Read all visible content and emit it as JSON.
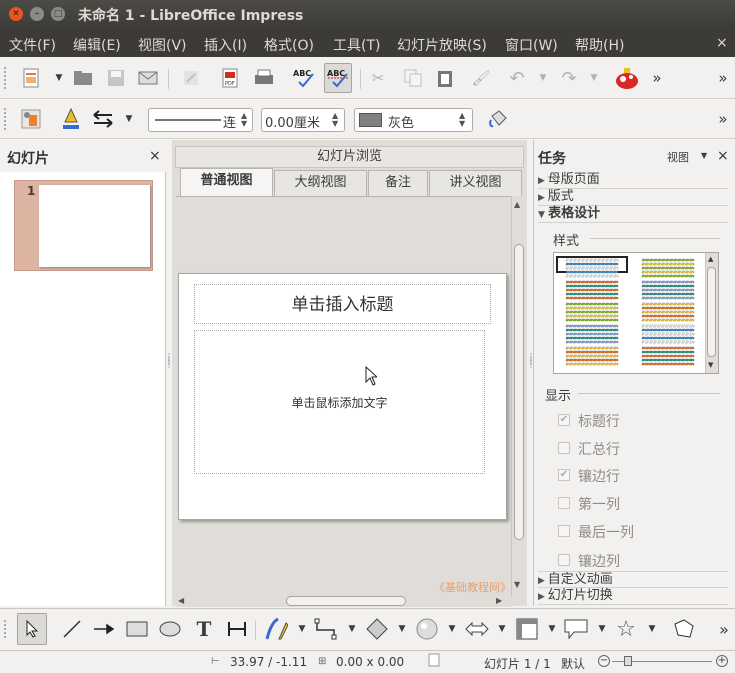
{
  "window": {
    "title": "未命名 1 - LibreOffice Impress",
    "close": "✕",
    "min": "–",
    "max": "□"
  },
  "menu": [
    {
      "label": "文件(F)"
    },
    {
      "label": "编辑(E)"
    },
    {
      "label": "视图(V)"
    },
    {
      "label": "插入(I)"
    },
    {
      "label": "格式(O)"
    },
    {
      "label": "工具(T)"
    },
    {
      "label": "幻灯片放映(S)"
    },
    {
      "label": "窗口(W)"
    },
    {
      "label": "帮助(H)"
    }
  ],
  "menu_close": "×",
  "toolbar2": {
    "line_style": "连",
    "line_width": "0.00厘米",
    "area_color": "灰色"
  },
  "overflow": "»",
  "slides_panel": {
    "title": "幻灯片",
    "close": "×",
    "slide_number": "1"
  },
  "center": {
    "title": "幻灯片浏览",
    "tabs": [
      "普通视图",
      "大纲视图",
      "备注",
      "讲义视图"
    ],
    "title_placeholder": "单击插入标题",
    "content_placeholder": "单击鼠标添加文字",
    "watermark": "《基础教程网》"
  },
  "tasks": {
    "title": "任务",
    "view_label": "视图",
    "close": "×",
    "sections": [
      "母版页面",
      "版式",
      "表格设计"
    ],
    "style_label": "样式",
    "display_label": "显示",
    "options": [
      {
        "label": "标题行",
        "checked": true
      },
      {
        "label": "汇总行",
        "checked": false
      },
      {
        "label": "镶边行",
        "checked": true
      },
      {
        "label": "第一列",
        "checked": false
      },
      {
        "label": "最后一列",
        "checked": false
      },
      {
        "label": "镶边列",
        "checked": false
      }
    ],
    "bottom_sections": [
      "自定义动画",
      "幻灯片切换"
    ],
    "colors": [
      "#f0f0f0",
      "#4a90c8",
      "#e07a3a",
      "#3a9a8a",
      "#8fbf40",
      "#f0d060",
      "#9aa8d8"
    ]
  },
  "status": {
    "position": "33.97 / -1.11",
    "size": "0.00 x 0.00",
    "slide": "幻灯片 1 / 1",
    "layout": "默认"
  }
}
